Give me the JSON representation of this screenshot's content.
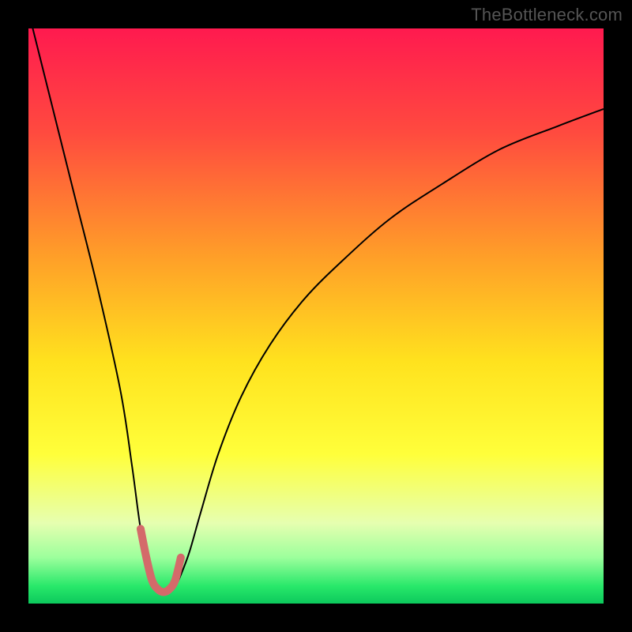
{
  "watermark": "TheBottleneck.com",
  "chart_data": {
    "type": "line",
    "title": "",
    "xlabel": "",
    "ylabel": "",
    "xlim": [
      0,
      100
    ],
    "ylim": [
      0,
      100
    ],
    "background_gradient_stops": [
      {
        "offset": 0,
        "color": "#ff1a4f"
      },
      {
        "offset": 18,
        "color": "#ff4a3f"
      },
      {
        "offset": 40,
        "color": "#ffa028"
      },
      {
        "offset": 58,
        "color": "#ffe21e"
      },
      {
        "offset": 74,
        "color": "#ffff3a"
      },
      {
        "offset": 86,
        "color": "#e6ffb0"
      },
      {
        "offset": 92,
        "color": "#9cff9c"
      },
      {
        "offset": 97,
        "color": "#28e86a"
      },
      {
        "offset": 100,
        "color": "#0cc95c"
      }
    ],
    "series": [
      {
        "name": "bottleneck-curve",
        "color": "#000000",
        "stroke_width": 2,
        "x": [
          0,
          4,
          8,
          12,
          16,
          18,
          19.5,
          21,
          22.5,
          24,
          25.5,
          26.5,
          28,
          30,
          33,
          37,
          42,
          48,
          55,
          63,
          72,
          82,
          92,
          100
        ],
        "y": [
          103,
          87,
          71,
          55,
          37,
          24,
          13,
          6,
          3,
          2,
          3,
          5,
          9,
          16,
          26,
          36,
          45,
          53,
          60,
          67,
          73,
          79,
          83,
          86
        ]
      },
      {
        "name": "valley-highlight",
        "color": "#d46a6a",
        "stroke_width": 10,
        "cap": "round",
        "x": [
          19.5,
          20.5,
          21.5,
          22.5,
          23.5,
          24.5,
          25.5,
          26.5
        ],
        "y": [
          13,
          8,
          4,
          2.5,
          2,
          2.5,
          4,
          8
        ]
      }
    ]
  }
}
